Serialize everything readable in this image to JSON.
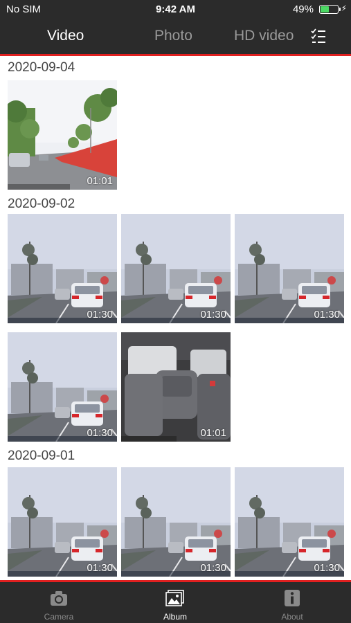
{
  "status_bar": {
    "carrier": "No SIM",
    "time": "9:42 AM",
    "battery_percent": "49%",
    "battery_level": 0.49,
    "charging_icon": "bolt-icon"
  },
  "top_tabs": {
    "items": [
      {
        "label": "Video",
        "active": true
      },
      {
        "label": "Photo",
        "active": false
      },
      {
        "label": "HD video",
        "active": false
      }
    ],
    "select_icon": "checklist-icon"
  },
  "groups": [
    {
      "date": "2020-09-04",
      "clips": [
        {
          "duration": "01:01",
          "scene": "road-day"
        }
      ]
    },
    {
      "date": "2020-09-02",
      "clips": [
        {
          "duration": "01:30",
          "scene": "road-rain"
        },
        {
          "duration": "01:30",
          "scene": "road-rain"
        },
        {
          "duration": "01:30",
          "scene": "road-rain"
        },
        {
          "duration": "01:30",
          "scene": "road-rain"
        },
        {
          "duration": "01:01",
          "scene": "car-interior"
        }
      ]
    },
    {
      "date": "2020-09-01",
      "clips": [
        {
          "duration": "01:30",
          "scene": "road-rain"
        },
        {
          "duration": "01:30",
          "scene": "road-rain"
        },
        {
          "duration": "01:30",
          "scene": "road-rain"
        }
      ]
    }
  ],
  "bottom_tabs": {
    "items": [
      {
        "label": "Camera",
        "icon": "camera-icon",
        "active": false
      },
      {
        "label": "Album",
        "icon": "album-icon",
        "active": true
      },
      {
        "label": "About",
        "icon": "info-icon",
        "active": false
      }
    ]
  },
  "colors": {
    "bar_background": "#2b2b2b",
    "accent_red": "#e02020",
    "battery_green": "#4cd964"
  }
}
